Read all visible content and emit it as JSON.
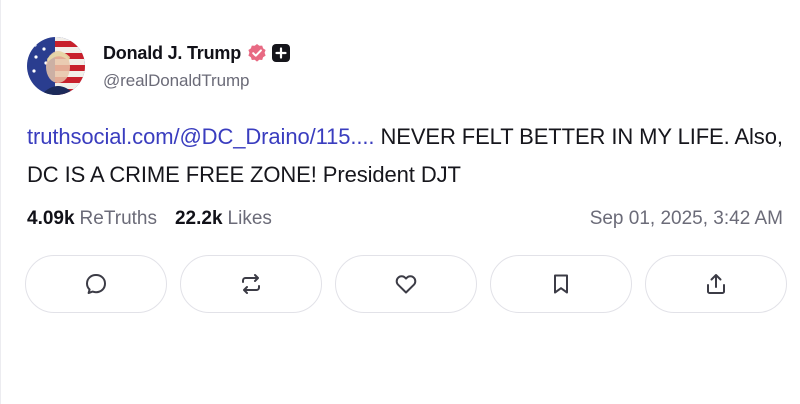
{
  "post": {
    "author": {
      "display_name": "Donald J. Trump",
      "handle": "@realDonaldTrump",
      "verified_icon": "verified-badge-icon",
      "extra_badge_icon": "plus-badge-icon"
    },
    "body": {
      "link_text": "truthsocial.com/@DC_Draino/115....",
      "text": " NEVER FELT BETTER IN MY LIFE. Also, DC IS A CRIME FREE ZONE! President DJT"
    },
    "stats": {
      "retruths_count": "4.09k",
      "retruths_label": "ReTruths",
      "likes_count": "22.2k",
      "likes_label": "Likes",
      "timestamp": "Sep 01, 2025, 3:42 AM"
    },
    "actions": [
      {
        "name": "reply",
        "icon": "reply-icon"
      },
      {
        "name": "retruth",
        "icon": "retruth-icon"
      },
      {
        "name": "like",
        "icon": "heart-icon"
      },
      {
        "name": "bookmark",
        "icon": "bookmark-icon"
      },
      {
        "name": "share",
        "icon": "share-icon"
      }
    ]
  },
  "colors": {
    "link": "#3a3dbf",
    "muted_text": "#6b6b78",
    "verified_badge": "#e86a83",
    "button_border": "#e2e2e8"
  }
}
